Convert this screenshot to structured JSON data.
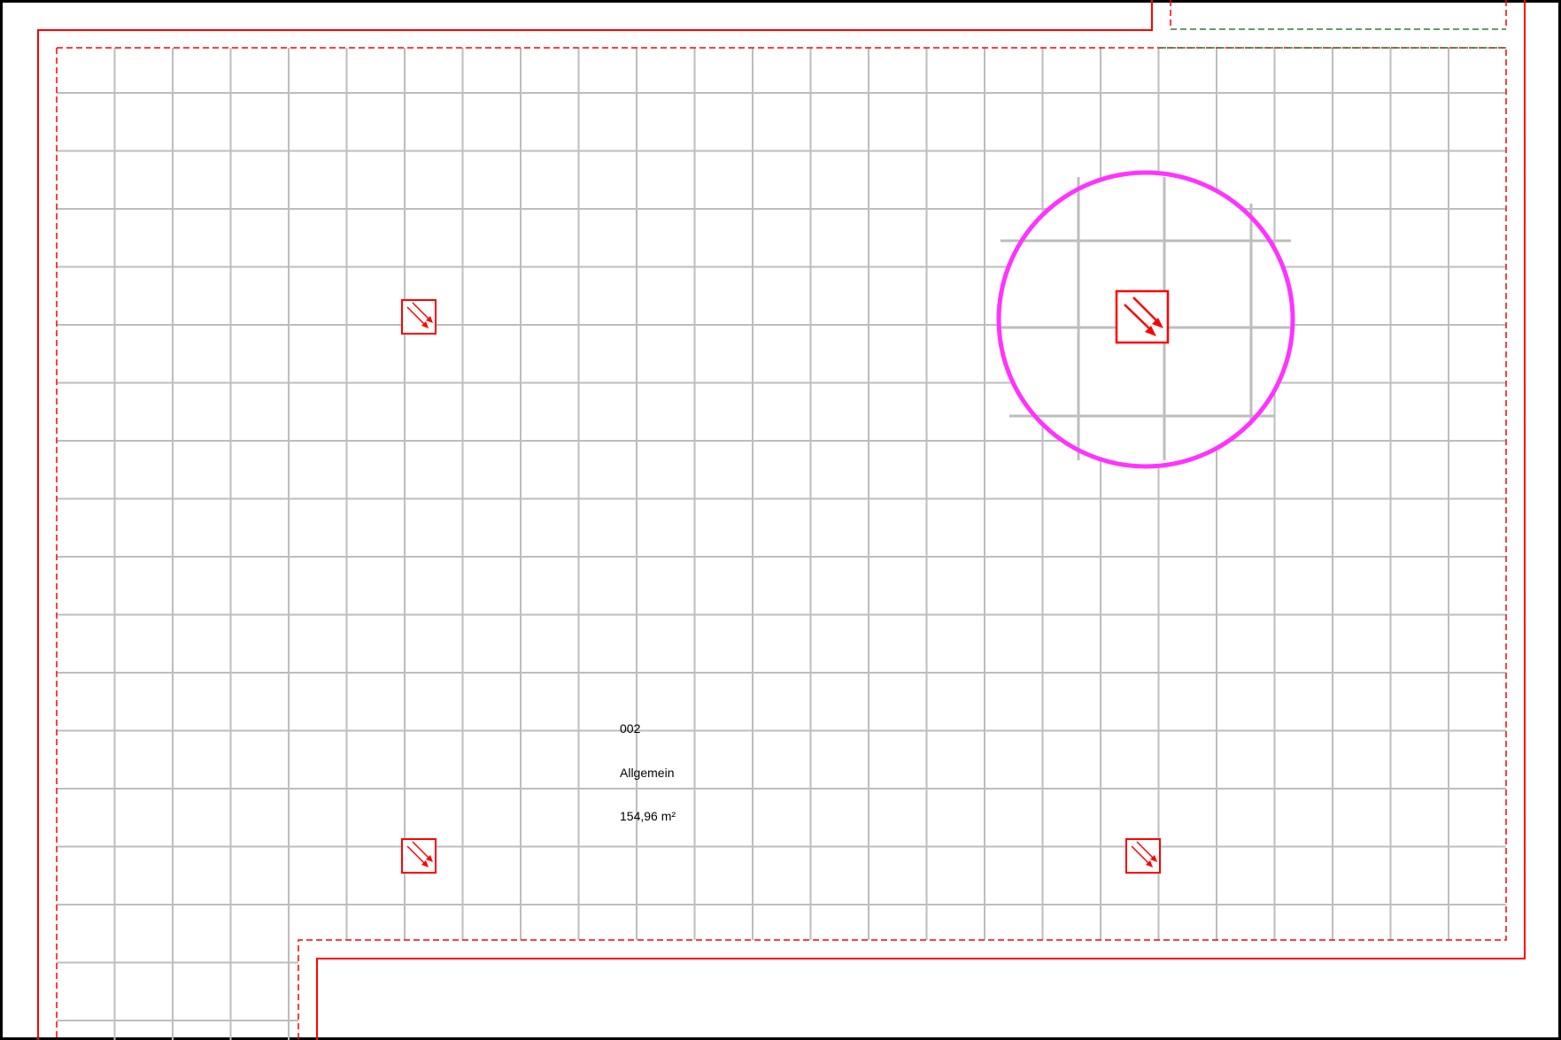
{
  "room": {
    "number": "002",
    "name": "Allgemein",
    "area": "154,96 m²"
  },
  "colors": {
    "frame": "#000000",
    "wall": "#ff0000",
    "grid": "#bdbdbd",
    "highlight": "#ff33ff",
    "green_dashed": "#2e7d32",
    "symbol": "#ff0000"
  },
  "icons": {
    "ceiling_symbol": "ceiling-light-diagonal-arrows-icon",
    "highlight": "highlight-circle"
  }
}
